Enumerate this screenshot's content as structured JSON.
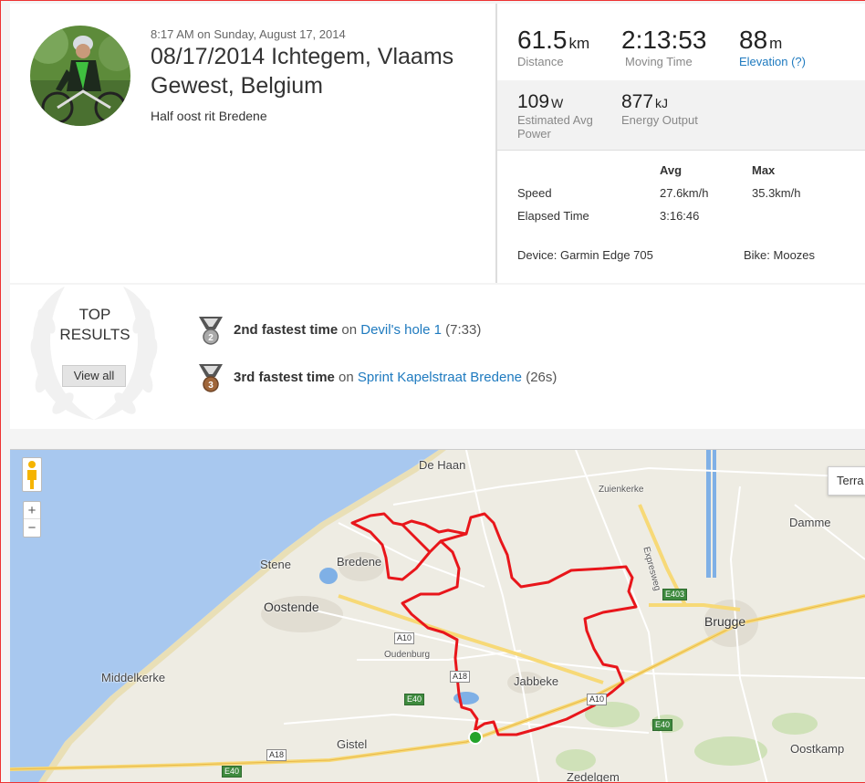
{
  "activity": {
    "datetime": "8:17 AM on Sunday, August 17, 2014",
    "title": "08/17/2014 Ichtegem, Vlaams Gewest, Belgium",
    "description": "Half oost rit Bredene"
  },
  "stats": {
    "distance": {
      "value": "61.5",
      "unit": "km",
      "label": "Distance"
    },
    "moving_time": {
      "value": "2:13:53",
      "label": "Moving Time"
    },
    "elevation": {
      "value": "88",
      "unit": "m",
      "label": "Elevation (?)"
    },
    "power": {
      "value": "109",
      "unit": "W",
      "label": "Estimated Avg Power"
    },
    "energy": {
      "value": "877",
      "unit": "kJ",
      "label": "Energy Output"
    },
    "table": {
      "col_avg": "Avg",
      "col_max": "Max",
      "speed_label": "Speed",
      "speed_avg": "27.6km/h",
      "speed_max": "35.3km/h",
      "elapsed_label": "Elapsed Time",
      "elapsed_avg": "3:16:46"
    },
    "device": "Device: Garmin Edge 705",
    "bike": "Bike: Moozes"
  },
  "top_results": {
    "title_line1": "TOP",
    "title_line2": "RESULTS",
    "view_all": "View all",
    "items": [
      {
        "medal": "2",
        "rank": "2nd fastest time",
        "on": "on",
        "segment": "Devil's hole 1",
        "time": "(7:33)"
      },
      {
        "medal": "3",
        "rank": "3rd fastest time",
        "on": "on",
        "segment": "Sprint Kapelstraat Bredene",
        "time": "(26s)"
      }
    ]
  },
  "map": {
    "zoom_in": "+",
    "zoom_out": "−",
    "terrain_button": "Terra",
    "places": [
      "De Haan",
      "Zuienkerke",
      "Damme",
      "Stene",
      "Bredene",
      "Oostende",
      "Brugge",
      "Middelkerke",
      "Oudenburg",
      "Jabbeke",
      "Gistel",
      "Oostkamp",
      "Zedelgem",
      "Expresweg"
    ],
    "roads": [
      "A10",
      "A18",
      "E40",
      "A10",
      "E40",
      "A18",
      "E40",
      "E403"
    ],
    "colors": {
      "route": "#e8161b",
      "sea": "#a8c8ef",
      "land": "#eeece3",
      "start": "#23a32a"
    }
  }
}
